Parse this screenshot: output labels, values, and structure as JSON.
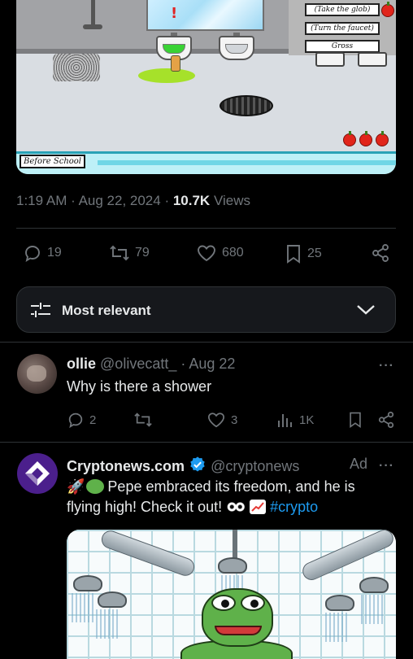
{
  "game_image": {
    "options": [
      "(Take the glob)",
      "(Turn the faucet)",
      "Gross"
    ],
    "label": "Before School"
  },
  "tweet": {
    "time": "1:19 AM",
    "date": "Aug 22, 2024",
    "views_count": "10.7K",
    "views_label": "Views",
    "replies": "19",
    "reposts": "79",
    "likes": "680",
    "bookmarks": "25"
  },
  "sort": {
    "label": "Most relevant",
    "icon": "sliders-icon"
  },
  "reply": {
    "name": "ollie",
    "handle": "@olivecatt_",
    "date": "· Aug 22",
    "text": "Why is there a shower",
    "replies": "2",
    "reposts": "",
    "likes": "3",
    "views": "1K"
  },
  "ad": {
    "name": "Cryptonews.com",
    "handle": "@cryptonews",
    "ad_label": "Ad",
    "text_line1": "Pepe embraced its freedom, and he is",
    "text_line2": "flying high! Check it out!",
    "hashtag": "#crypto",
    "colors": {
      "verified": "#1d9bf0",
      "logo": "#4b1f8c",
      "accent": "#1d9bf0"
    }
  }
}
